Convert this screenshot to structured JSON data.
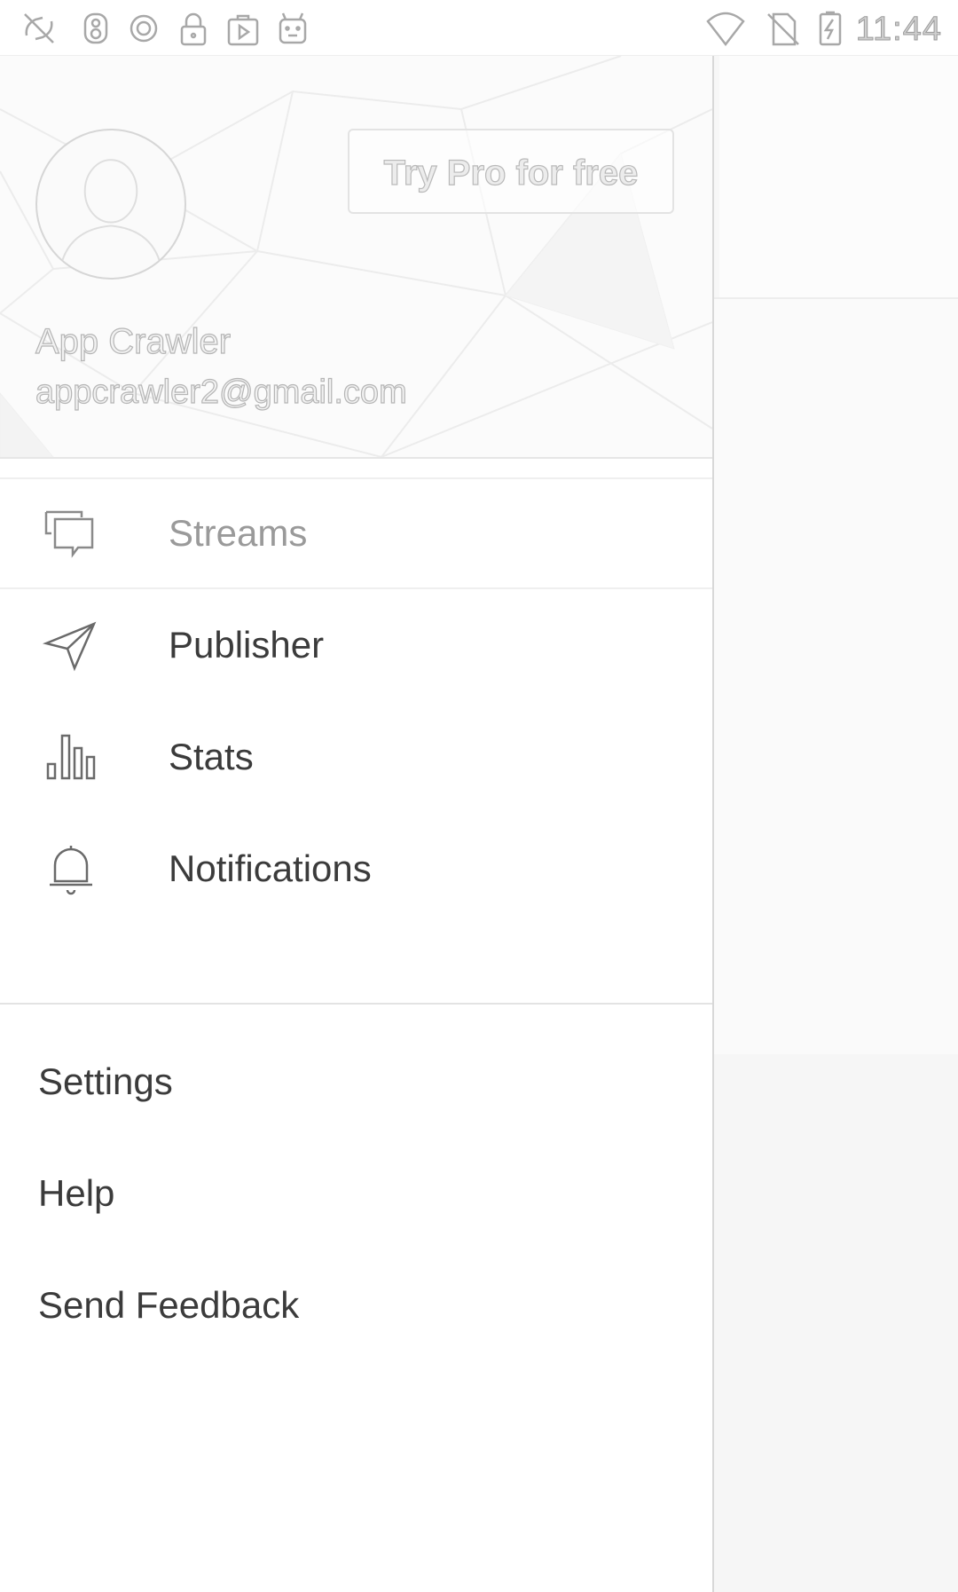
{
  "status_bar": {
    "time": "11:44",
    "left_icons": [
      "sync-off-icon",
      "lab-icon",
      "record-icon",
      "lock-icon",
      "play-store-icon",
      "android-icon"
    ],
    "right_icons": [
      "wifi-icon",
      "no-sim-icon",
      "battery-charging-icon"
    ]
  },
  "drawer": {
    "header": {
      "try_pro_label": "Try Pro for free",
      "user_name": "App Crawler",
      "user_email": "appcrawler2@gmail.com"
    },
    "nav_items": [
      {
        "label": "Streams",
        "icon": "streams-icon",
        "selected": true
      },
      {
        "label": "Publisher",
        "icon": "send-icon",
        "selected": false
      },
      {
        "label": "Stats",
        "icon": "bar-chart-icon",
        "selected": false
      },
      {
        "label": "Notifications",
        "icon": "bell-icon",
        "selected": false
      }
    ],
    "secondary_items": [
      {
        "label": "Settings"
      },
      {
        "label": "Help"
      },
      {
        "label": "Send Feedback"
      }
    ]
  }
}
